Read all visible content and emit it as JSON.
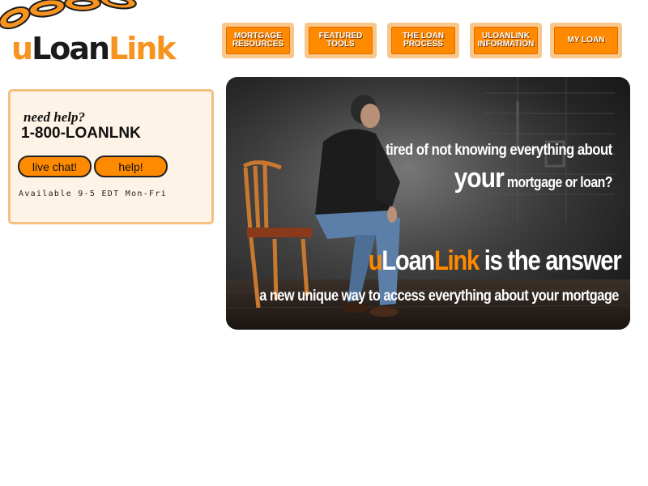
{
  "brand": {
    "u": "u",
    "loan": "Loan",
    "link": "Link",
    "accent_color": "#f7931e"
  },
  "nav": [
    {
      "label": "MORTGAGE\nRESOURCES"
    },
    {
      "label": "FEATURED\nTOOLS"
    },
    {
      "label": "THE LOAN\nPROCESS"
    },
    {
      "label": "uLoanLink\nINFORMATION"
    },
    {
      "label": "MY LOAN"
    }
  ],
  "help": {
    "title": "need help?",
    "phone": "1-800-LOANLNK",
    "chat_label": "live chat!",
    "help_label": "help!",
    "hours": "Available 9-5 EDT Mon-Fri"
  },
  "hero": {
    "line1": "tired of not knowing everything about",
    "line2_big": "your",
    "line2_rest": "mortgage or loan?",
    "answer_u": "u",
    "answer_loan": "Loan",
    "answer_link": "Link",
    "answer_rest": "is the answer",
    "tagline": "a new unique way to access everything about your mortgage"
  },
  "colors": {
    "nav_button": "#ff8a00",
    "nav_frame": "#f9c78a",
    "help_bg": "#fdf3e6",
    "help_border": "#f4c07f"
  }
}
